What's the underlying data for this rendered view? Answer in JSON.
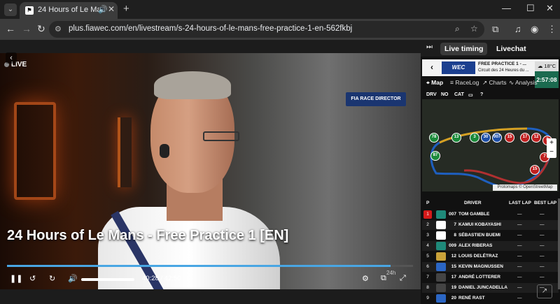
{
  "browser": {
    "tab_title": "24 Hours of Le Mans - Free",
    "url": "plus.fiawec.com/en/livestream/s-24-hours-of-le-mans-free-practice-1-en-562fkbj",
    "icons": [
      "tab-menu-icon",
      "audio-icon",
      "close-icon",
      "new-tab-icon",
      "minimize-icon",
      "maximize-icon",
      "window-close-icon",
      "back-icon",
      "forward-icon",
      "reload-icon",
      "site-info-icon",
      "zoom-icon",
      "bookmark-icon",
      "extensions-icon",
      "media-icon",
      "profile-icon",
      "menu-icon"
    ]
  },
  "video": {
    "live_label": "LIVE",
    "fia_badge": "RACE DIRECTOR",
    "title": "24 Hours of Le Mans - Free Practice 1 [EN]",
    "time": "40:28 / 42:50",
    "progress_fraction": 0.944,
    "volume_fraction": 1.0,
    "controls": [
      "pause-icon",
      "rewind-10-icon",
      "forward-10-icon",
      "volume-icon",
      "settings-icon",
      "pip-icon",
      "fullscreen-icon"
    ]
  },
  "panel": {
    "tabs": [
      "Live timing",
      "Livechat"
    ],
    "active_tab": "Live timing",
    "session_logo": "WEC",
    "session_title": "FREE PRACTICE 1 - ...",
    "session_sub": "Circuit des 24 Heures du ...",
    "weather": "18°C",
    "clock": "2:57:08",
    "subtabs": [
      "Map",
      "RaceLog",
      "Charts",
      "Analysis"
    ],
    "filters": [
      "DRV",
      "NO",
      "CAT",
      "?"
    ],
    "map_credit": "Protomaps © OpenStreetMap",
    "zoom_in": "+",
    "zoom_out": "−",
    "cars_on_map": [
      "78",
      "87",
      "13",
      "3",
      "30",
      "007",
      "15",
      "17",
      "12",
      "8",
      "7",
      "15"
    ],
    "table_headers": {
      "pos": "P",
      "driver": "DRIVER",
      "last": "LAST LAP",
      "best": "BEST LAP"
    },
    "rows": [
      {
        "pos": "1",
        "num": "007",
        "driver": "TOM GAMBLE",
        "last": "—",
        "best": "—",
        "color": "#1f8a7a"
      },
      {
        "pos": "2",
        "num": "7",
        "driver": "KAMUI KOBAYASHI",
        "last": "—",
        "best": "—",
        "color": "#ffffff"
      },
      {
        "pos": "3",
        "num": "8",
        "driver": "SÉBASTIEN BUEMI",
        "last": "—",
        "best": "—",
        "color": "#ffffff"
      },
      {
        "pos": "4",
        "num": "009",
        "driver": "ALEX RIBERAS",
        "last": "—",
        "best": "—",
        "color": "#1f8a7a"
      },
      {
        "pos": "5",
        "num": "12",
        "driver": "LOUIS DELÉTRAZ",
        "last": "—",
        "best": "—",
        "color": "#c9a23a"
      },
      {
        "pos": "6",
        "num": "15",
        "driver": "KEVIN MAGNUSSEN",
        "last": "—",
        "best": "—",
        "color": "#2b66c4"
      },
      {
        "pos": "7",
        "num": "17",
        "driver": "ANDRÉ LOTTERER",
        "last": "—",
        "best": "—",
        "color": "#444444"
      },
      {
        "pos": "8",
        "num": "19",
        "driver": "DANIEL JUNCADELLA",
        "last": "—",
        "best": "—",
        "color": "#444444"
      },
      {
        "pos": "9",
        "num": "20",
        "driver": "RENÉ RAST",
        "last": "—",
        "best": "—",
        "color": "#2b66c4"
      }
    ]
  }
}
